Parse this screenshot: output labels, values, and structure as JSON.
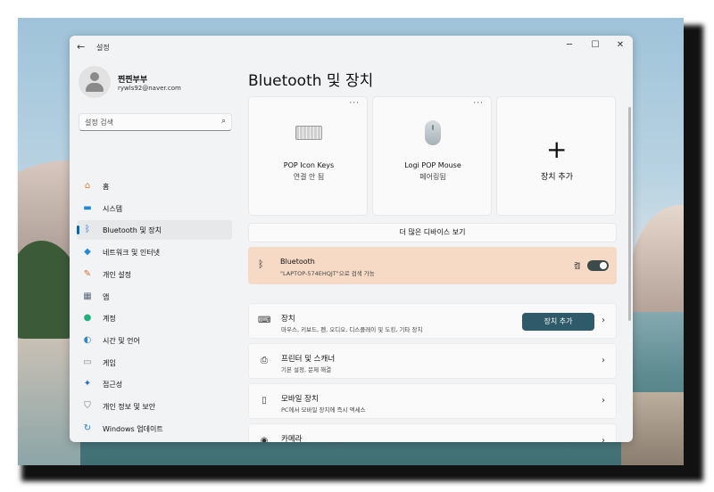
{
  "window": {
    "title": "설정",
    "controls": {
      "minimize": "─",
      "maximize": "☐",
      "close": "✕"
    }
  },
  "user": {
    "name": "찐찐부부",
    "email": "rywls92@naver.com"
  },
  "search": {
    "placeholder": "설정 검색"
  },
  "sidebar": {
    "items": [
      {
        "label": "홈",
        "icon": "home-icon",
        "color": "#e0803a"
      },
      {
        "label": "시스템",
        "icon": "system-icon",
        "color": "#1e88d6"
      },
      {
        "label": "Bluetooth 및 장치",
        "icon": "bluetooth-icon",
        "color": "#2c74c8",
        "active": true
      },
      {
        "label": "네트워크 및 인터넷",
        "icon": "network-icon",
        "color": "#1c8ad8"
      },
      {
        "label": "개인 설정",
        "icon": "brush-icon",
        "color": "#d9662f"
      },
      {
        "label": "앱",
        "icon": "apps-icon",
        "color": "#5e6b78"
      },
      {
        "label": "계정",
        "icon": "account-icon",
        "color": "#1fb07a"
      },
      {
        "label": "시간 및 언어",
        "icon": "globe-clock-icon",
        "color": "#2f86d0"
      },
      {
        "label": "게임",
        "icon": "gamepad-icon",
        "color": "#7b8690"
      },
      {
        "label": "접근성",
        "icon": "accessibility-icon",
        "color": "#1f6fc7"
      },
      {
        "label": "개인 정보 및 보안",
        "icon": "shield-icon",
        "color": "#6d7883"
      },
      {
        "label": "Windows 업데이트",
        "icon": "update-icon",
        "color": "#1f7fd4"
      }
    ]
  },
  "main": {
    "title": "Bluetooth 및 장치",
    "cards": [
      {
        "name": "POP Icon Keys",
        "status": "연결 안 됨",
        "more": "···"
      },
      {
        "name": "Logi POP Mouse",
        "status": "페어링됨",
        "more": "···"
      },
      {
        "name": "장치 추가"
      }
    ],
    "more_devices": "더 많은 디바이스 보기",
    "bluetooth": {
      "title": "Bluetooth",
      "subtitle": "\"LAPTOP-574EHQJT\"으로 검색 가능",
      "state": "켬",
      "highlight": "#f7dac6"
    },
    "rows": [
      {
        "title": "장치",
        "subtitle": "마우스, 키보드, 펜, 오디오, 디스플레이 및 도킹, 기타 장치",
        "button": "장치 추가",
        "icon": "devices-icon"
      },
      {
        "title": "프린터 및 스캐너",
        "subtitle": "기본 설정, 문제 해결",
        "icon": "printer-icon"
      },
      {
        "title": "모바일 장치",
        "subtitle": "PC에서 모바일 장치에 즉시 액세스",
        "icon": "phone-icon"
      },
      {
        "title": "카메라",
        "subtitle": "",
        "icon": "camera-icon"
      }
    ],
    "accent_button": "#2e5a6a"
  }
}
